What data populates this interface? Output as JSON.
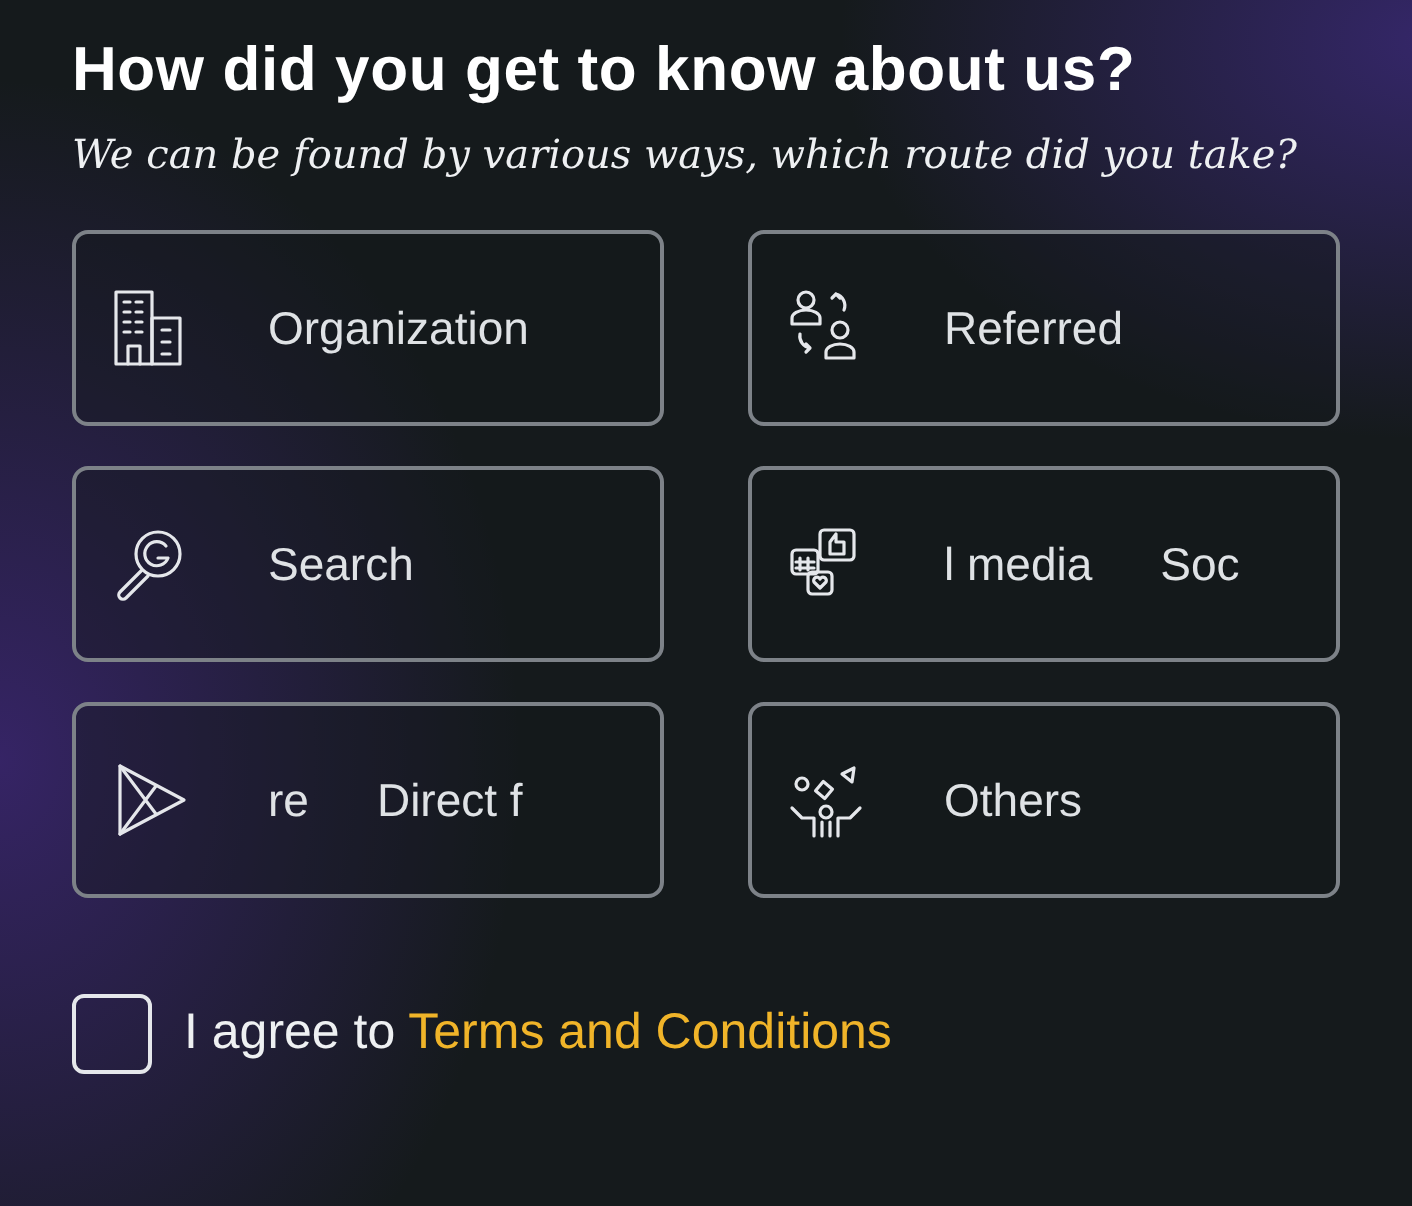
{
  "title": "How did you get to know about us?",
  "subtitle": "We can be found by various ways, which route did you take?",
  "options": [
    {
      "labels": [
        "Organization"
      ],
      "selected": false
    },
    {
      "labels": [
        "Referred"
      ],
      "selected": false
    },
    {
      "labels": [
        "Search"
      ],
      "selected": false
    },
    {
      "labels": [
        "l media",
        "Soc"
      ],
      "selected": false
    },
    {
      "labels": [
        "re",
        "Direct f"
      ],
      "selected": false
    },
    {
      "labels": [
        "Others"
      ],
      "selected": false
    }
  ],
  "agreement": {
    "checked": false,
    "text": "I agree to",
    "link": "Terms and Conditions"
  }
}
